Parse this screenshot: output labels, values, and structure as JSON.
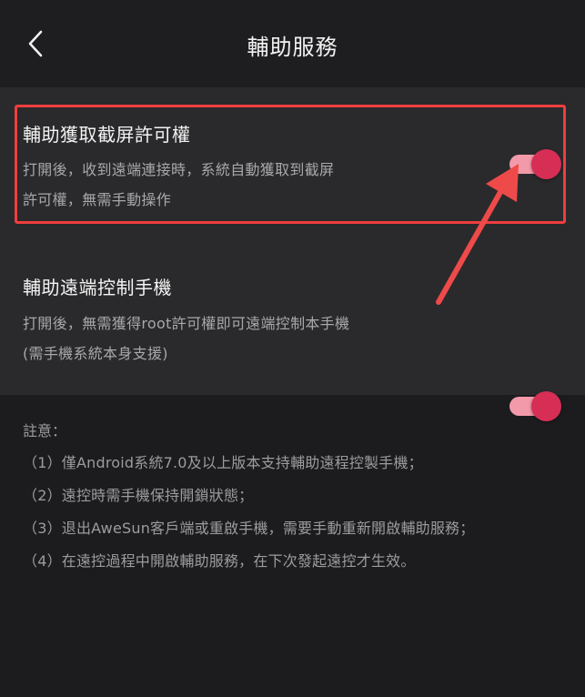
{
  "header": {
    "title": "輔助服務",
    "back_icon": "chevron-left-icon"
  },
  "settings": [
    {
      "title": "輔助獲取截屏許可權",
      "desc_lines": [
        "打開後，收到遠端連接時，系統自動獲取到截屏",
        "許可權，無需手動操作"
      ],
      "enabled": true,
      "highlighted": true
    },
    {
      "title": "輔助遠端控制手機",
      "desc_lines": [
        "打開後，無需獲得root許可權即可遠端控制本手機",
        "(需手機系統本身支援)"
      ],
      "enabled": true,
      "highlighted": false
    }
  ],
  "notes": {
    "heading": "註意：",
    "items": [
      "（1）僅Android系統7.0及以上版本支持輔助遠程控製手機；",
      "（2）遠控時需手機保持開鎖狀態；",
      "（3）退出AweSun客戶端或重啟手機，需要手動重新開啟輔助服務；",
      "（4）在遠控過程中開啟輔助服務，在下次發起遠控才生效。"
    ]
  },
  "colors": {
    "background": "#1c1c1e",
    "card": "#2a2a2c",
    "toggle_knob": "#d62e55",
    "toggle_track": "#f39aaa",
    "highlight": "#ef3e3e",
    "arrow": "#ef4a4a"
  }
}
